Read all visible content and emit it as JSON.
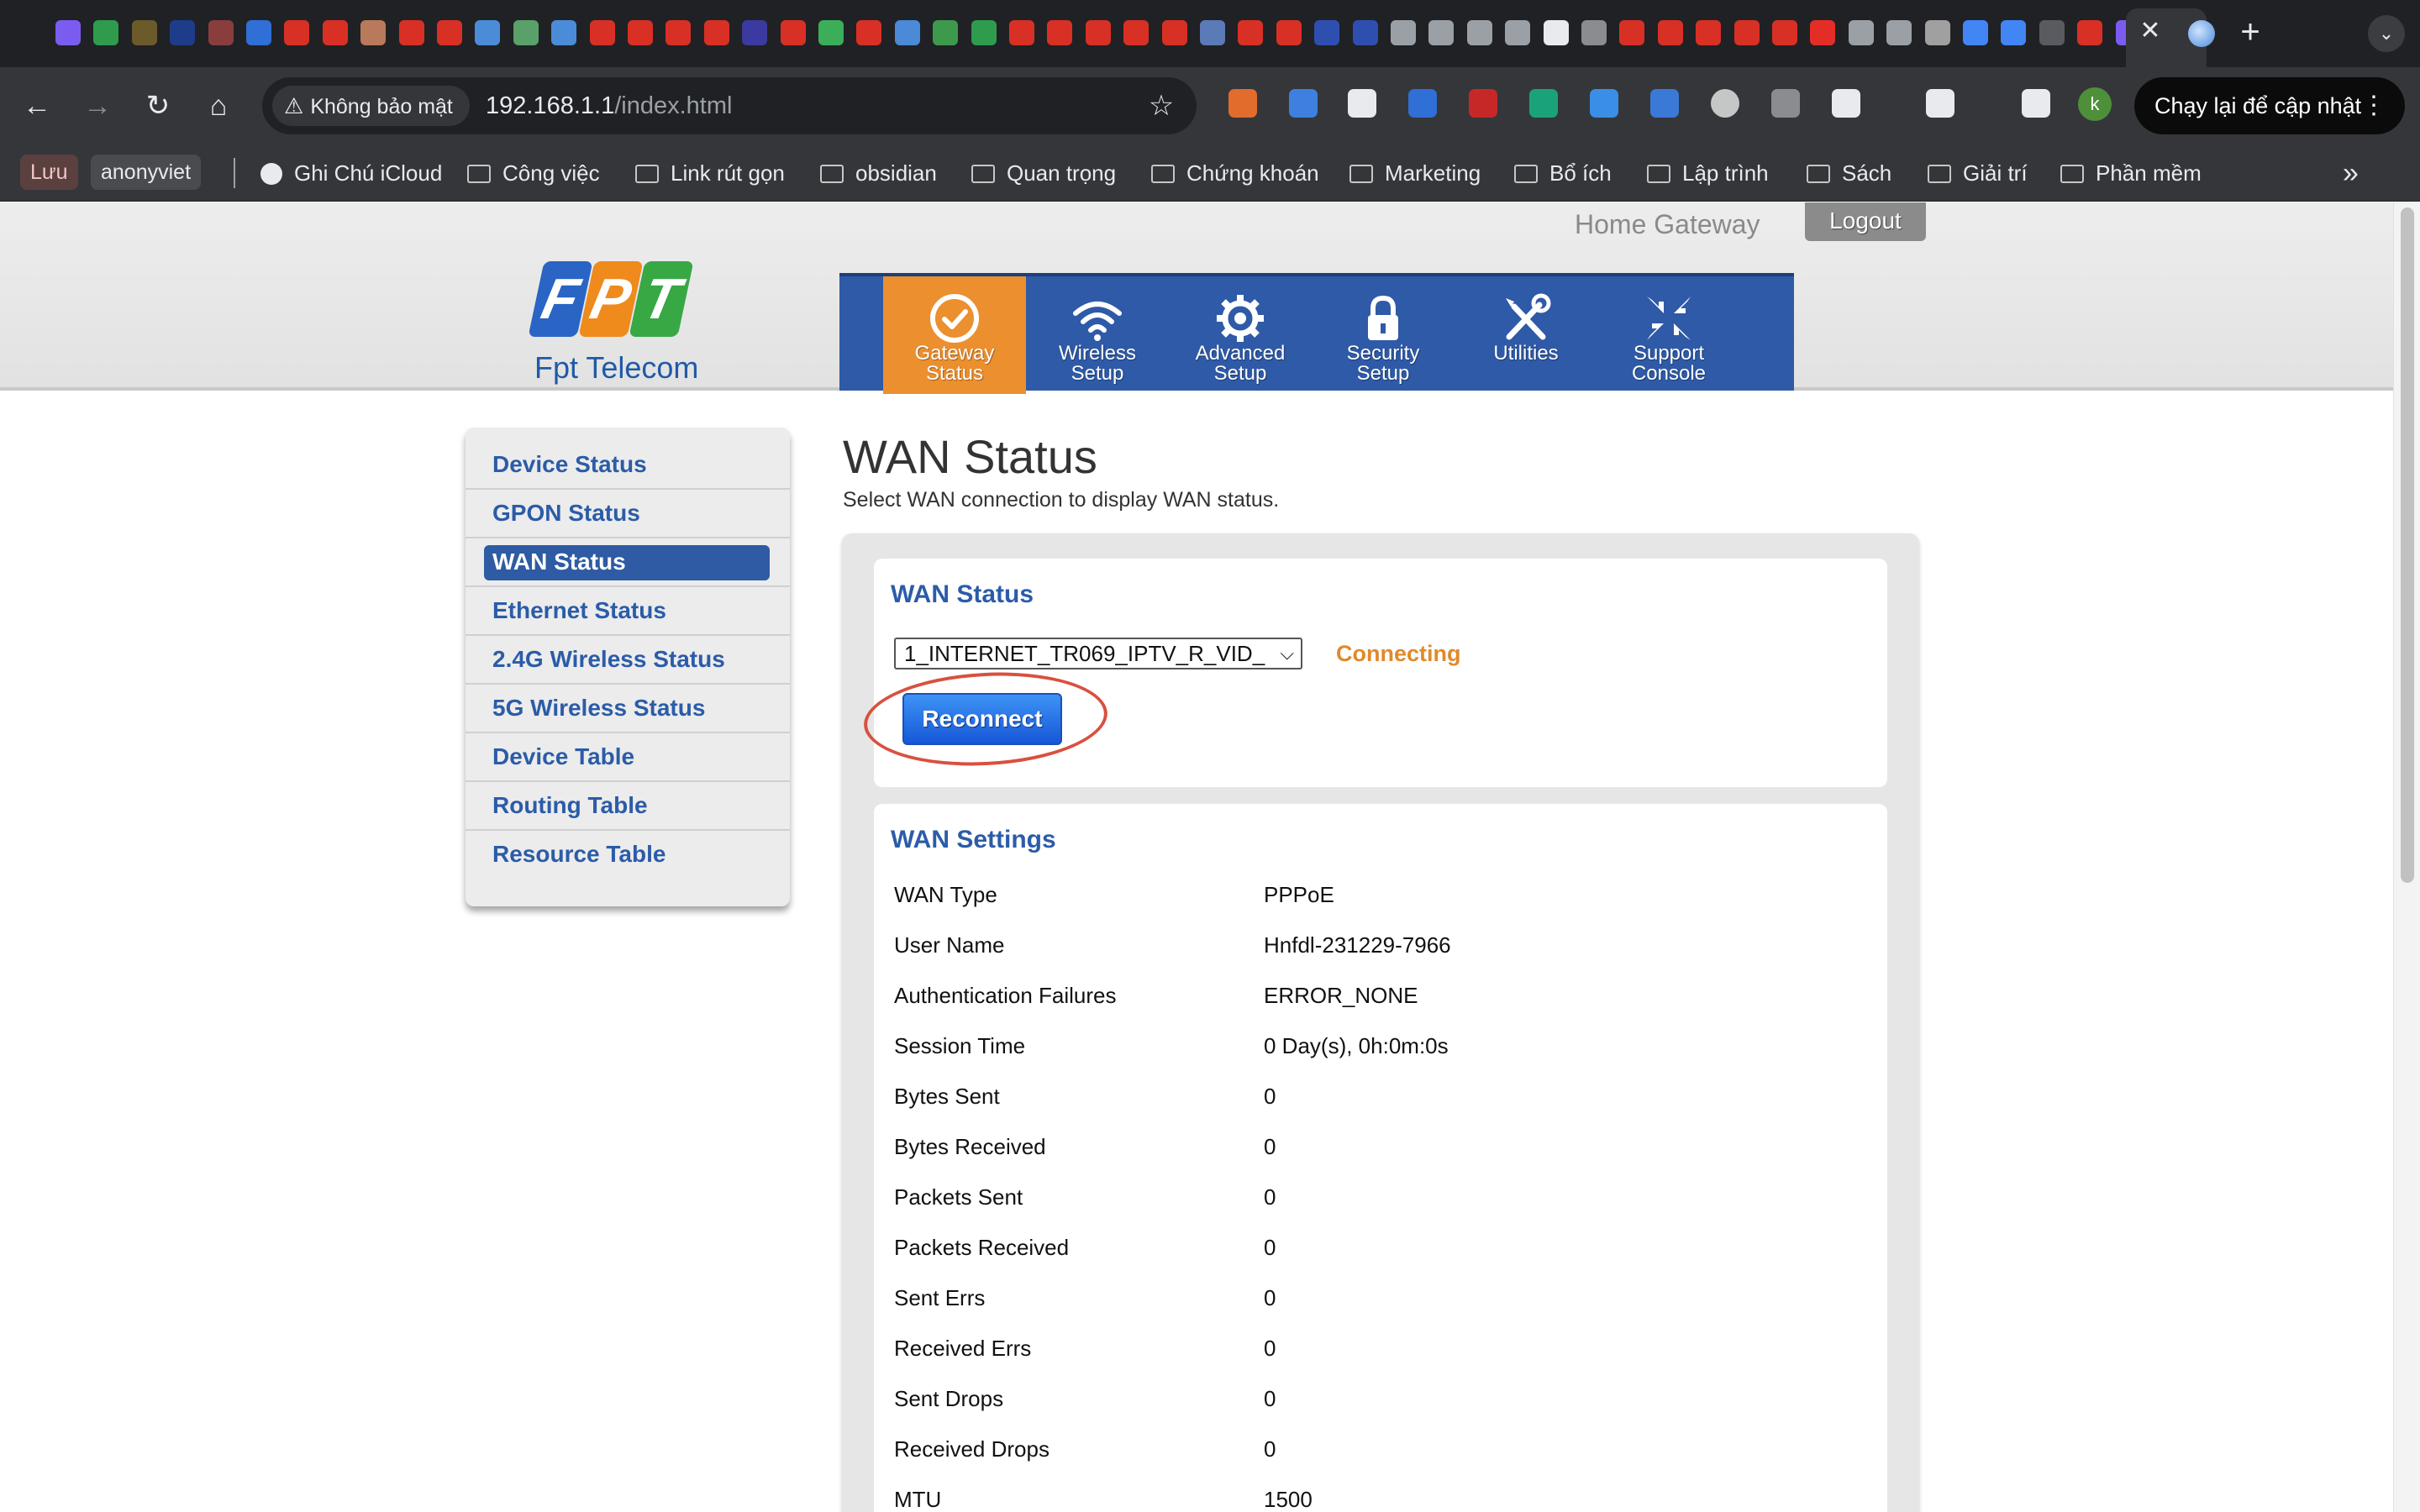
{
  "browser": {
    "security_label": "Không bảo mật",
    "url_host": "192.168.1.1",
    "url_path": "/index.html",
    "update_button_label": "Chạy lại để cập nhật",
    "profile_initial": "k",
    "tab_colors": [
      "#7b5cf0",
      "#2e9b4d",
      "#6b5a2a",
      "#1d3c8a",
      "#8a3d3d",
      "#2f6fd6",
      "#d93025",
      "#d93025",
      "#b87a5a",
      "#d93025",
      "#d93025",
      "#4b8cd8",
      "#5aa06a",
      "#4b8cd8",
      "#d93025",
      "#d93025",
      "#d93025",
      "#d93025",
      "#3a3aa0",
      "#d93025",
      "#3cae5a",
      "#d93025",
      "#4a8ad6",
      "#3d9a4c",
      "#2e9b4d",
      "#d93025",
      "#d93025",
      "#d93025",
      "#d93025",
      "#d93025",
      "#5a7ab8",
      "#d93025",
      "#d93025",
      "#2f4fb0",
      "#2f4fb0",
      "#9aa0a6",
      "#9aa0a6",
      "#9aa0a6",
      "#9aa0a6",
      "#e8eaed",
      "#8a8c90",
      "#d93025",
      "#d93025",
      "#d93025",
      "#d93025",
      "#d93025",
      "#e52d27",
      "#9aa0a6",
      "#9aa0a6",
      "#a0a0a0",
      "#4285f4",
      "#4285f4",
      "#5a5b60",
      "#d93025",
      "#7b5cf0"
    ],
    "extension_colors": [
      "#e26c2b",
      "#3f7fe0",
      "#e8eaed",
      "#2f6fd6",
      "#c62828",
      "#1aa37a",
      "#3a8ee6",
      "#3a7ad6",
      "#c4c7c5",
      "#8a8c90",
      "#e8eaed",
      "#e8eaed",
      "#e8eaed"
    ]
  },
  "bookmarks": {
    "chips": [
      {
        "label": "Lưu",
        "style": "red"
      },
      {
        "label": "anonyviet",
        "style": "gray"
      }
    ],
    "items": [
      {
        "label": "Ghi Chú iCloud",
        "icon": "globe-icon"
      },
      {
        "label": "Công việc",
        "icon": "folder-icon"
      },
      {
        "label": "Link rút gọn",
        "icon": "folder-icon"
      },
      {
        "label": "obsidian",
        "icon": "folder-icon"
      },
      {
        "label": "Quan trọng",
        "icon": "folder-icon"
      },
      {
        "label": "Chứng khoán",
        "icon": "folder-icon"
      },
      {
        "label": "Marketing",
        "icon": "folder-icon"
      },
      {
        "label": "Bổ ích",
        "icon": "folder-icon"
      },
      {
        "label": "Lập trình",
        "icon": "folder-icon"
      },
      {
        "label": "Sách",
        "icon": "folder-icon"
      },
      {
        "label": "Giải trí",
        "icon": "folder-icon"
      },
      {
        "label": "Phần mềm",
        "icon": "folder-icon"
      }
    ]
  },
  "router": {
    "header_title": "Home Gateway",
    "logout_label": "Logout",
    "logo_letters": [
      "F",
      "P",
      "T"
    ],
    "logo_text": "Fpt Telecom",
    "colors": {
      "nav_blue": "#2f5aa7",
      "nav_active": "#ec8f2e",
      "link_blue": "#2b5ca8",
      "status_orange": "#e08a2a"
    },
    "nav": [
      {
        "line1": "Gateway",
        "line2": "Status",
        "icon": "check-circle-icon",
        "active": true
      },
      {
        "line1": "Wireless",
        "line2": "Setup",
        "icon": "wifi-icon",
        "active": false
      },
      {
        "line1": "Advanced",
        "line2": "Setup",
        "icon": "gear-icon",
        "active": false
      },
      {
        "line1": "Security",
        "line2": "Setup",
        "icon": "lock-icon",
        "active": false
      },
      {
        "line1": "Utilities",
        "line2": "",
        "icon": "tools-icon",
        "active": false
      },
      {
        "line1": "Support",
        "line2": "Console",
        "icon": "arrows-inward-icon",
        "active": false
      }
    ],
    "sidebar": [
      {
        "label": "Device Status",
        "selected": false
      },
      {
        "label": "GPON Status",
        "selected": false
      },
      {
        "label": "WAN Status",
        "selected": true
      },
      {
        "label": "Ethernet Status",
        "selected": false
      },
      {
        "label": "2.4G Wireless Status",
        "selected": false
      },
      {
        "label": "5G Wireless Status",
        "selected": false
      },
      {
        "label": "Device Table",
        "selected": false
      },
      {
        "label": "Routing Table",
        "selected": false
      },
      {
        "label": "Resource Table",
        "selected": false
      }
    ],
    "content": {
      "title": "WAN Status",
      "subtitle": "Select WAN connection to display WAN status.",
      "status_card": {
        "title": "WAN Status",
        "selected_connection": "1_INTERNET_TR069_IPTV_R_VID_",
        "connection_state": "Connecting",
        "reconnect_label": "Reconnect"
      },
      "settings_card": {
        "title": "WAN Settings",
        "rows": [
          {
            "label": "WAN Type",
            "value": "PPPoE"
          },
          {
            "label": "User Name",
            "value": "Hnfdl-231229-7966"
          },
          {
            "label": "Authentication Failures",
            "value": "ERROR_NONE"
          },
          {
            "label": "Session Time",
            "value": "0 Day(s), 0h:0m:0s"
          },
          {
            "label": "Bytes Sent",
            "value": "0"
          },
          {
            "label": "Bytes Received",
            "value": "0"
          },
          {
            "label": "Packets Sent",
            "value": "0"
          },
          {
            "label": "Packets Received",
            "value": "0"
          },
          {
            "label": "Sent Errs",
            "value": "0"
          },
          {
            "label": "Received Errs",
            "value": "0"
          },
          {
            "label": "Sent Drops",
            "value": "0"
          },
          {
            "label": "Received Drops",
            "value": "0"
          },
          {
            "label": "MTU",
            "value": "1500"
          }
        ]
      }
    }
  }
}
